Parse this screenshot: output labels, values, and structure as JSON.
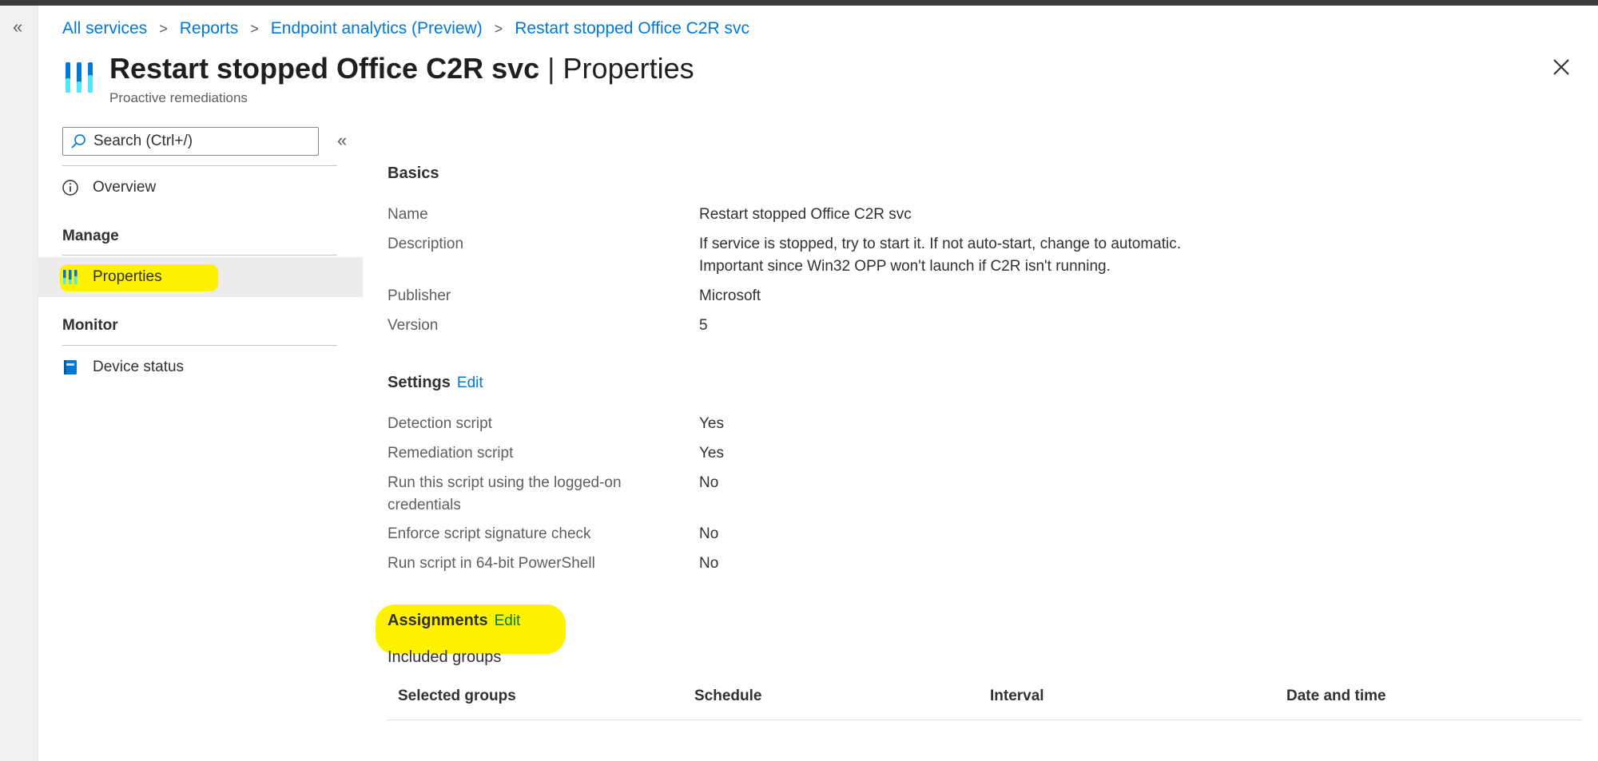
{
  "breadcrumb": [
    "All services",
    "Reports",
    "Endpoint analytics (Preview)",
    "Restart stopped Office C2R svc"
  ],
  "header": {
    "title_main": "Restart stopped Office C2R svc",
    "title_sep": "|",
    "title_suffix": "Properties",
    "subtitle": "Proactive remediations"
  },
  "sidebar": {
    "search_placeholder": "Search (Ctrl+/)",
    "overview": "Overview",
    "manage_heading": "Manage",
    "properties": "Properties",
    "monitor_heading": "Monitor",
    "device_status": "Device status"
  },
  "basics": {
    "title": "Basics",
    "rows": [
      {
        "label": "Name",
        "value": "Restart stopped Office C2R svc"
      },
      {
        "label": "Description",
        "value": "If service is stopped, try to start it. If not auto-start, change to automatic.",
        "value2": "Important since Win32 OPP won't launch if C2R isn't running."
      },
      {
        "label": "Publisher",
        "value": "Microsoft"
      },
      {
        "label": "Version",
        "value": "5"
      }
    ]
  },
  "settings": {
    "title": "Settings",
    "edit": "Edit",
    "rows": [
      {
        "label": "Detection script",
        "value": "Yes"
      },
      {
        "label": "Remediation script",
        "value": "Yes"
      },
      {
        "label": "Run this script using the logged-on",
        "label2": "credentials",
        "value": "No"
      },
      {
        "label": "Enforce script signature check",
        "value": "No"
      },
      {
        "label": "Run script in 64-bit PowerShell",
        "value": "No"
      }
    ]
  },
  "assignments": {
    "title": "Assignments",
    "edit": "Edit",
    "included_groups": "Included groups",
    "columns": [
      "Selected groups",
      "Schedule",
      "Interval",
      "Date and time"
    ]
  },
  "colors": {
    "accent": "#0078d4",
    "highlight": "#fff200"
  }
}
